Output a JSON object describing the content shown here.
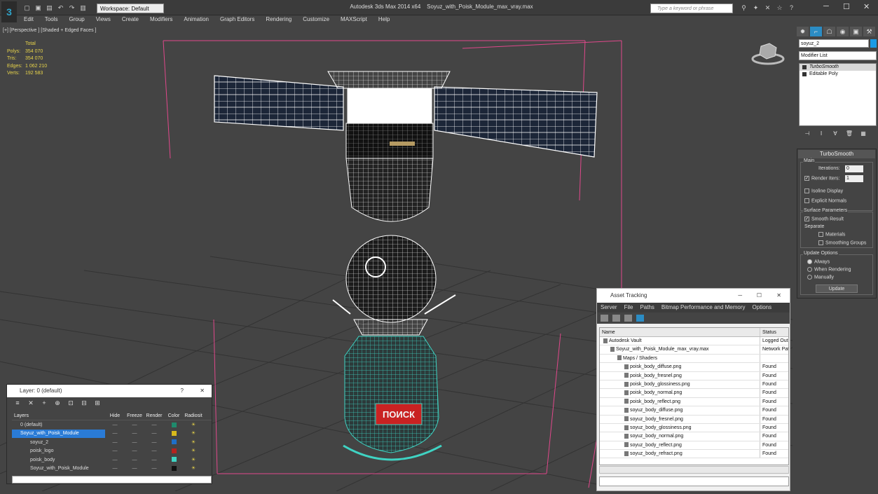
{
  "app": {
    "title": "Autodesk 3ds Max  2014 x64",
    "file": "Soyuz_with_Poisk_Module_max_vray.max",
    "logo": "3",
    "workspace": "Workspace: Default",
    "search_placeholder": "Type a keyword or phrase"
  },
  "menu": [
    "Edit",
    "Tools",
    "Group",
    "Views",
    "Create",
    "Modifiers",
    "Animation",
    "Graph Editors",
    "Rendering",
    "Customize",
    "MAXScript",
    "Help"
  ],
  "viewport": {
    "label": "[+] [Perspective ] [Shaded + Edged Faces ]",
    "stats": {
      "header": "Total",
      "rows": [
        {
          "k": "Polys:",
          "v": "354 070"
        },
        {
          "k": "Tris:",
          "v": "354 070"
        },
        {
          "k": "Edges:",
          "v": "1 062 210"
        },
        {
          "k": "Verts:",
          "v": "192 583"
        }
      ]
    },
    "logo_text": "ПОИСК"
  },
  "command_panel": {
    "object_name": "soyuz_2",
    "modifier_list": "Modifier List",
    "stack": [
      "TurboSmooth",
      "Editable Poly"
    ],
    "rollout": {
      "title": "TurboSmooth",
      "main": "Main",
      "iterations_label": "Iterations:",
      "iterations": "0",
      "render_iters_label": "Render Iters:",
      "render_iters": "1",
      "isoline": "Isoline Display",
      "explicit": "Explicit Normals",
      "surface": "Surface Parameters",
      "smooth_result": "Smooth Result",
      "separate": "Separate",
      "materials": "Materials",
      "smoothing_groups": "Smoothing Groups",
      "update_options": "Update Options",
      "always": "Always",
      "when_rendering": "When Rendering",
      "manually": "Manually",
      "update": "Update"
    }
  },
  "assets": {
    "title": "Asset Tracking",
    "menu": [
      "Server",
      "File",
      "Paths",
      "Bitmap Performance and Memory",
      "Options"
    ],
    "col_name": "Name",
    "col_status": "Status",
    "rows": [
      {
        "name": "Autodesk Vault",
        "status": "Logged Out",
        "indent": 1
      },
      {
        "name": "Soyuz_with_Poisk_Module_max_vray.max",
        "status": "Network Path",
        "indent": 2
      },
      {
        "name": "Maps / Shaders",
        "status": "",
        "indent": 3
      },
      {
        "name": "poisk_body_diffuse.png",
        "status": "Found",
        "indent": 4
      },
      {
        "name": "poisk_body_fresnel.png",
        "status": "Found",
        "indent": 4
      },
      {
        "name": "poisk_body_glossiness.png",
        "status": "Found",
        "indent": 4
      },
      {
        "name": "poisk_body_normal.png",
        "status": "Found",
        "indent": 4
      },
      {
        "name": "poisk_body_reflect.png",
        "status": "Found",
        "indent": 4
      },
      {
        "name": "soyuz_body_diffuse.png",
        "status": "Found",
        "indent": 4
      },
      {
        "name": "soyuz_body_fresnel.png",
        "status": "Found",
        "indent": 4
      },
      {
        "name": "soyuz_body_glossiness.png",
        "status": "Found",
        "indent": 4
      },
      {
        "name": "soyuz_body_normal.png",
        "status": "Found",
        "indent": 4
      },
      {
        "name": "soyuz_body_reflect.png",
        "status": "Found",
        "indent": 4
      },
      {
        "name": "soyuz_body_refract.png",
        "status": "Found",
        "indent": 4
      }
    ]
  },
  "layers": {
    "title": "Layer: 0 (default)",
    "help": "?",
    "columns": [
      "Layers",
      "Hide",
      "Freeze",
      "Render",
      "Color",
      "Radiosit"
    ],
    "rows": [
      {
        "name": "0 (default)",
        "color": "#1f8a6c",
        "selected": false
      },
      {
        "name": "Soyuz_with_Poisk_Module",
        "color": "#d8b91c",
        "selected": true
      },
      {
        "name": "soyuz_2",
        "color": "#1f6fc8",
        "selected": false
      },
      {
        "name": "poisk_logo",
        "color": "#b5231f",
        "selected": false
      },
      {
        "name": "poisk_body",
        "color": "#3fd3c3",
        "selected": false
      },
      {
        "name": "Soyuz_with_Poisk_Module",
        "color": "#111111",
        "selected": false
      }
    ]
  },
  "colors": {
    "accent": "#2b8cc4",
    "wire": "#ffffff",
    "poisk": "#3fd3c3",
    "grid": "#2d2d2d",
    "bbox": "#e0488b"
  }
}
